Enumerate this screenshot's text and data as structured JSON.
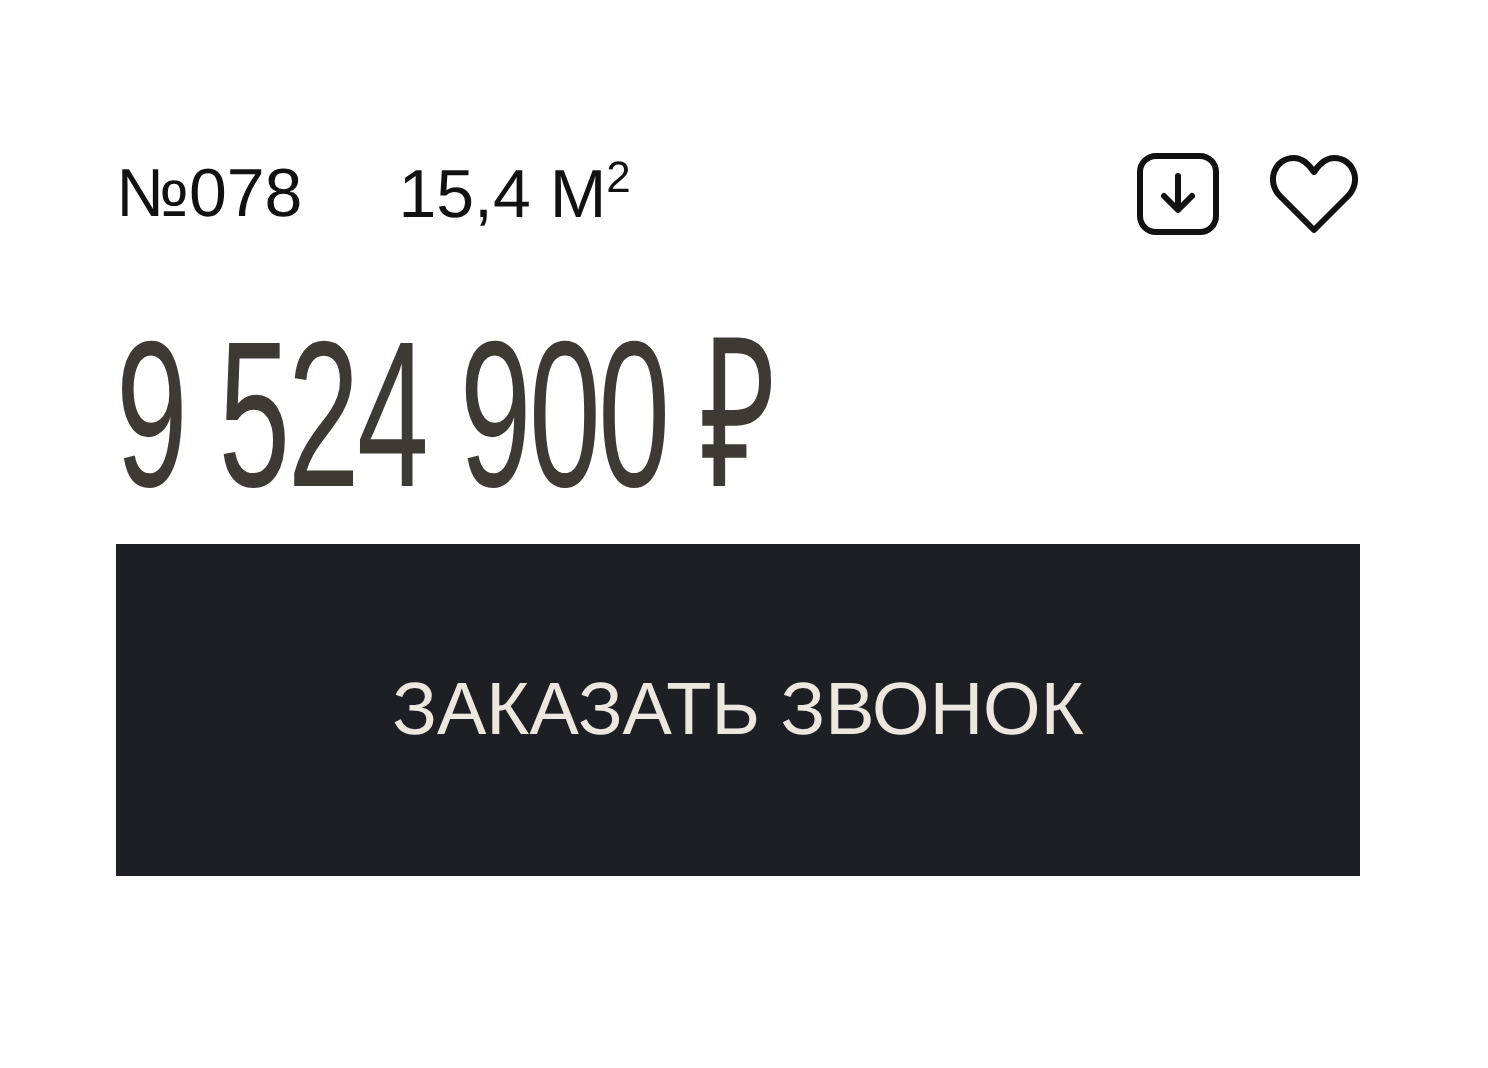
{
  "listing": {
    "number": "№078",
    "area": "15,4 М$^{2}$",
    "price": "9 524 900 ₽",
    "favorite": false
  },
  "button": {
    "label": "ЗАКАЗАТЬ ЗВОНОК"
  }
}
